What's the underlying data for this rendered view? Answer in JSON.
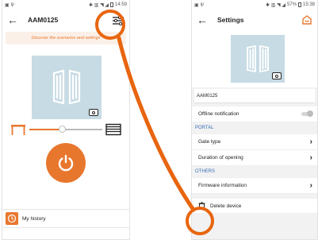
{
  "left": {
    "status": {
      "time": "14:59"
    },
    "header": {
      "title": "AAM0125"
    },
    "banner": "Discover the scenarios and settings",
    "slider_position": 0.45,
    "history_label": "My history"
  },
  "right": {
    "status": {
      "battery": "57%",
      "time": "15:38"
    },
    "header": {
      "title": "Settings"
    },
    "name_value": "AAM0125",
    "offline_label": "Offline notification",
    "offline_enabled": false,
    "sections": {
      "portal": "PORTAL",
      "others": "OTHERS"
    },
    "items": {
      "gate_type": "Gate type",
      "duration": "Duration of opening",
      "firmware": "Firmware information"
    },
    "delete_label": "Delete device"
  },
  "colors": {
    "accent": "#e8772e",
    "callout": "#e8650f",
    "image_bg": "#c7dbe4",
    "section_blue": "#3a6fb8"
  },
  "icons": [
    "back-arrow-icon",
    "settings-sliders-icon",
    "camera-icon",
    "gate-open-icon",
    "gate-closed-icon",
    "power-icon",
    "history-clock-icon",
    "chevron-right-icon",
    "trash-icon",
    "home-logo-icon"
  ]
}
